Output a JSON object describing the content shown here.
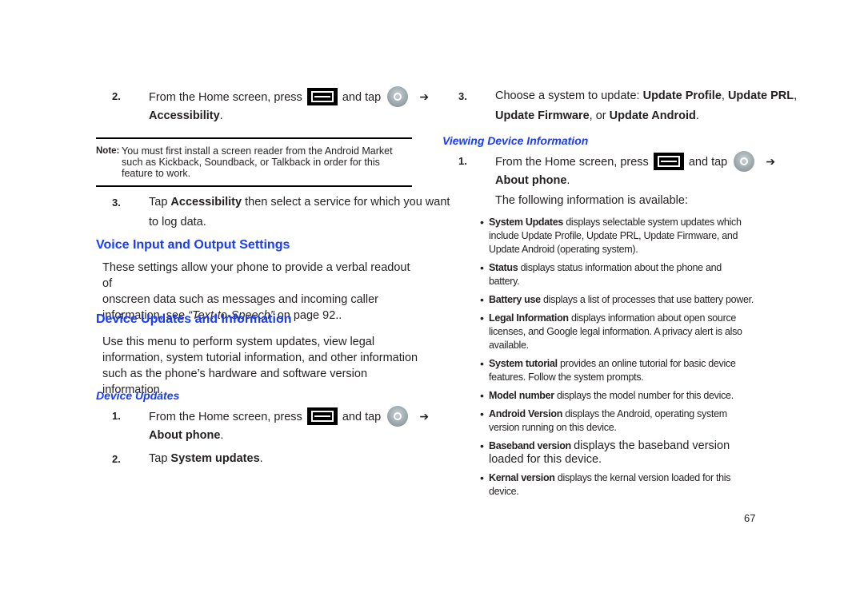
{
  "left": {
    "step2": {
      "num": "2.",
      "pre": "From the Home screen, press",
      "and_tap": "and tap",
      "arrow": "➔",
      "target": "Accessibility",
      "end": ".",
      "icons": [
        "menu-key-icon",
        "settings-icon"
      ]
    },
    "note": {
      "label": "Note:",
      "text": "You must first install a screen reader from the Android Market such as Kickback, Soundback, or Talkback in order for this feature to work."
    },
    "step3": {
      "num": "3.",
      "pre": "Tap",
      "bold": "Accessibility",
      "post": "then select a service for which you want",
      "line2": "to log data."
    },
    "voice_heading": "Voice Input and Output Settings",
    "voice_para": {
      "line1": "These settings allow your phone to provide a verbal readout of",
      "line2": "onscreen data such as messages and incoming caller",
      "line3_pre": "information, see",
      "line3_link": "“Text-to-Speech”",
      "line3_post": "on page 92.."
    },
    "device_heading": "Device Updates and Information",
    "device_para": {
      "line1": "Use this menu to perform system updates, view legal",
      "line2": "information, system tutorial information, and other information",
      "line3": "such as the phone’s hardware and software version information."
    },
    "device_updates_subheading": "Device Updates",
    "du_step1": {
      "num": "1.",
      "pre": "From the Home screen, press",
      "and_tap": "and tap",
      "arrow": "➔",
      "target": "About phone",
      "end": "."
    },
    "du_step2": {
      "num": "2.",
      "pre": "Tap",
      "bold": "System updates",
      "end": "."
    }
  },
  "right": {
    "step3": {
      "num": "3.",
      "pre": "Choose a system to update:",
      "opt1": "Update Profile",
      "sep1": ",",
      "opt2": "Update PRL",
      "sep2": ",",
      "opt3": "Update Firmware",
      "sep3": ", or",
      "opt4": "Update Android",
      "end": "."
    },
    "viewing_heading": "Viewing Device Information",
    "vd_step1": {
      "num": "1.",
      "pre": "From the Home screen, press",
      "and_tap": "and tap",
      "arrow": "➔",
      "target": "About phone",
      "end": "."
    },
    "following": "The following information is available:",
    "bullets": [
      {
        "bold": "System Updates",
        "rest": "displays selectable system updates which include Update Profile, Update PRL, Update Firmware, and Update Android (operating system)."
      },
      {
        "bold": "Status",
        "rest": "displays status information about the phone and battery."
      },
      {
        "bold": "Battery use",
        "rest": "displays a list of processes that use battery power."
      },
      {
        "bold": "Legal Information",
        "rest": "displays information about open source licenses, and Google legal information. A privacy alert is also available."
      },
      {
        "bold": "System tutorial",
        "rest": "provides an online tutorial for basic device features. Follow the system prompts."
      },
      {
        "bold": "Model number",
        "rest": "displays the model number for this device."
      },
      {
        "bold": "Android Version",
        "rest": "displays the Android, operating system version running on this device."
      },
      {
        "bold": "Baseband version",
        "rest": "displays the baseband version loaded for this device."
      },
      {
        "bold": "Kernal version",
        "rest": "displays the kernal version loaded for this device."
      }
    ]
  },
  "page_number": "67",
  "colors": {
    "heading": "#1a3cf5",
    "text": "#231f20"
  }
}
